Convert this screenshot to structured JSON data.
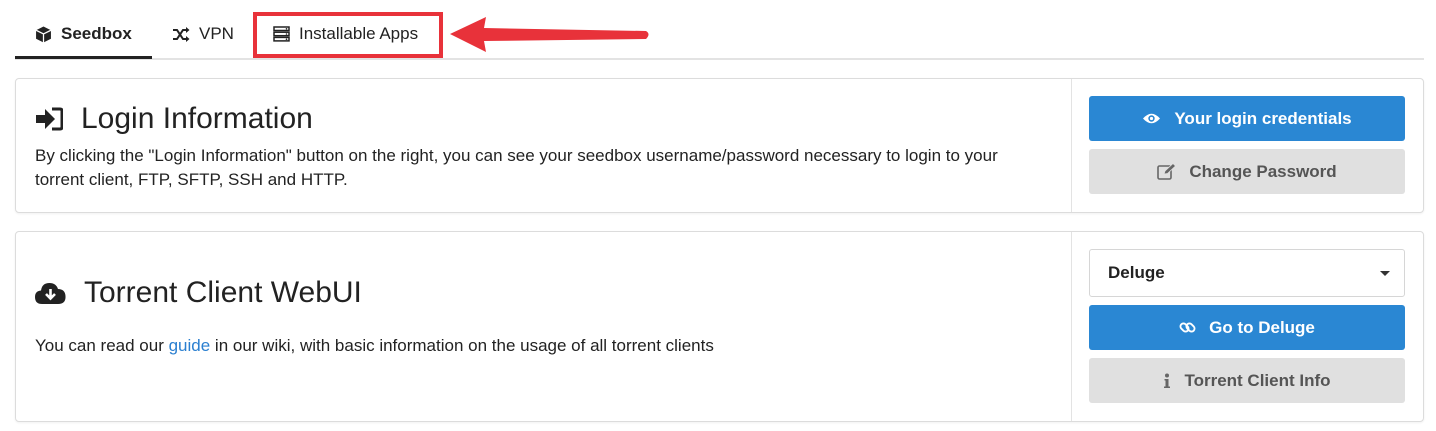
{
  "tabs": [
    {
      "label": "Seedbox",
      "icon": "cube-icon",
      "active": true
    },
    {
      "label": "VPN",
      "icon": "shuffle-icon",
      "active": false
    },
    {
      "label": "Installable Apps",
      "icon": "server-icon",
      "active": false
    }
  ],
  "annotation": {
    "color": "#e8323a"
  },
  "login_panel": {
    "title": "Login Information",
    "description": "By clicking the \"Login Information\" button on the right, you can see your seedbox username/password necessary to login to your torrent client, FTP, SFTP, SSH and HTTP.",
    "credentials_button": "Your login credentials",
    "change_password_button": "Change Password"
  },
  "torrent_panel": {
    "title": "Torrent Client WebUI",
    "text_before_link": "You can read our ",
    "link_text": "guide",
    "text_after_link": " in our wiki, with basic information on the usage of all torrent clients",
    "client_select_value": "Deluge",
    "go_button": "Go to Deluge",
    "info_button": "Torrent Client Info"
  },
  "colors": {
    "primary": "#2a87d3",
    "secondary": "#e0e0e0",
    "link": "#2a7fd0"
  }
}
